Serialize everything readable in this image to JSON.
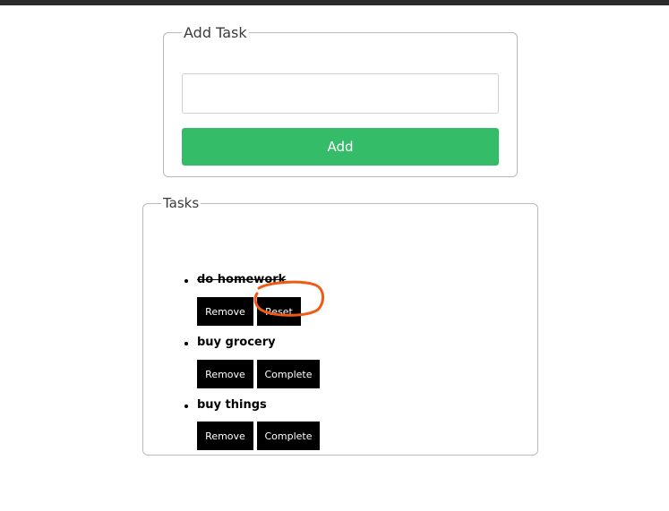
{
  "add_task": {
    "legend": "Add Task",
    "input_value": "",
    "input_placeholder": "",
    "add_label": "Add",
    "add_color": "#35bc68"
  },
  "tasks": {
    "legend": "Tasks",
    "items": [
      {
        "text": "do homework",
        "completed": true,
        "remove_label": "Remove",
        "toggle_label": "Reset"
      },
      {
        "text": "buy grocery",
        "completed": false,
        "remove_label": "Remove",
        "toggle_label": "Complete"
      },
      {
        "text": "buy things",
        "completed": false,
        "remove_label": "Remove",
        "toggle_label": "Complete"
      }
    ]
  },
  "annotation": {
    "color": "#f05a14"
  }
}
